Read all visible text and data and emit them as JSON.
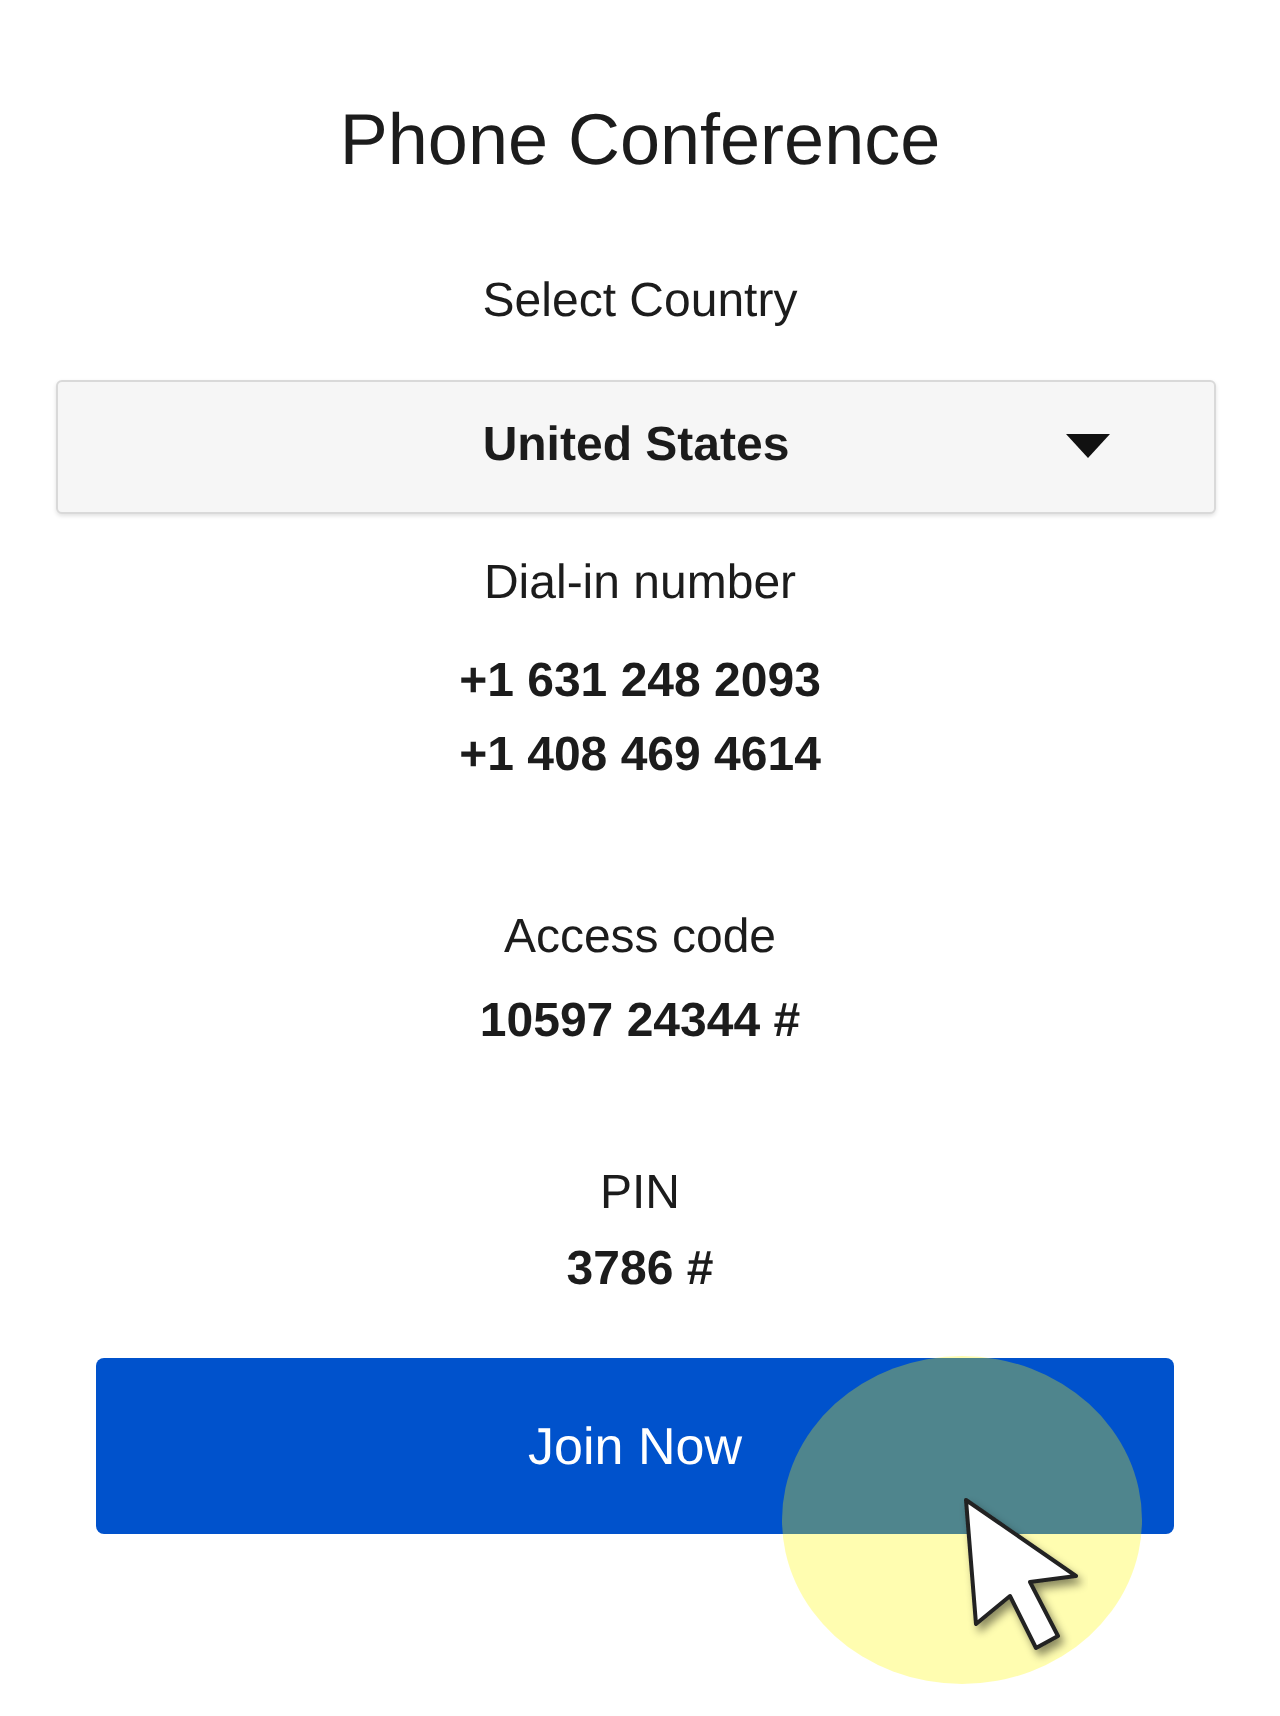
{
  "title": "Phone Conference",
  "country": {
    "label": "Select Country",
    "value": "United States"
  },
  "dial_in": {
    "label": "Dial-in number",
    "numbers": [
      "+1 631 248 2093",
      "+1 408 469 4614"
    ]
  },
  "access_code": {
    "label": "Access code",
    "value": "10597 24344 #"
  },
  "pin": {
    "label": "PIN",
    "value": "3786 #"
  },
  "join_button": {
    "label": "Join Now"
  }
}
